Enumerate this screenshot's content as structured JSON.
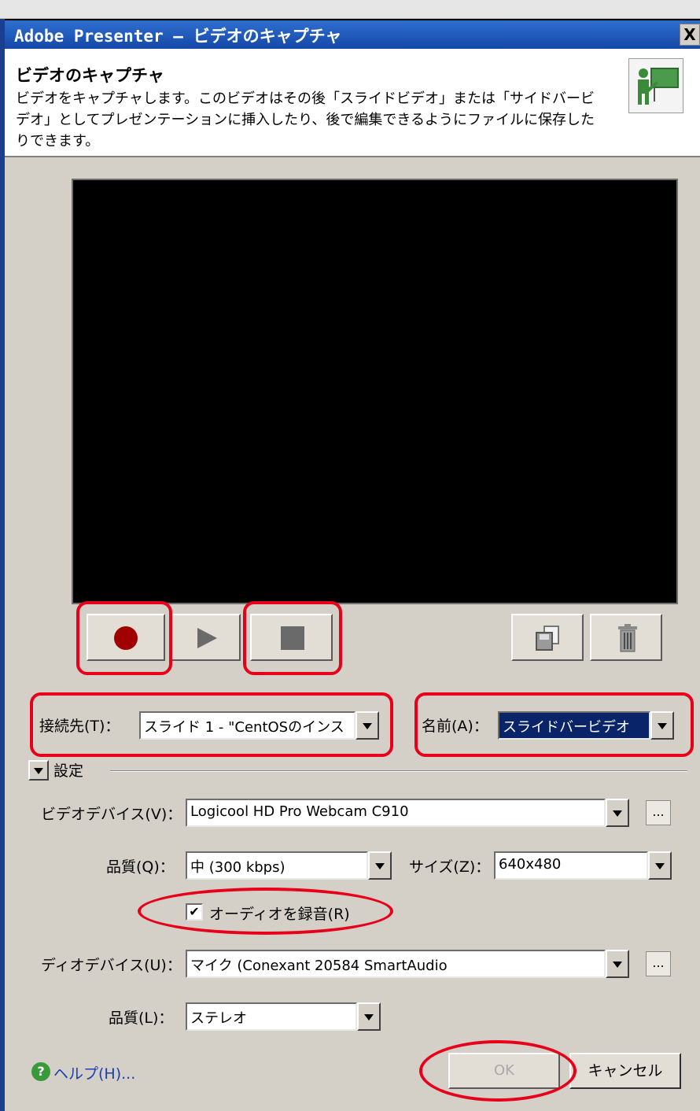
{
  "window": {
    "title": "Adobe Presenter – ビデオのキャプチャ",
    "close_glyph": "X"
  },
  "header": {
    "title": "ビデオのキャプチャ",
    "description": "ビデオをキャプチャします。このビデオはその後「スライドビデオ」または「サイドバービデオ」としてプレゼンテーションに挿入したり、後で編集できるようにファイルに保存したりできます。",
    "icon": "presenter-icon"
  },
  "controls": {
    "record": {
      "icon": "record-icon",
      "color": "#a00000"
    },
    "play": {
      "icon": "play-icon"
    },
    "stop": {
      "icon": "stop-icon"
    },
    "save": {
      "icon": "save-icon"
    },
    "delete": {
      "icon": "trash-icon"
    }
  },
  "target": {
    "label": "接続先(T)：",
    "value": "スライド 1 - \"CentOSのインス"
  },
  "name": {
    "label": "名前(A)：",
    "value": "スライドバービデオ"
  },
  "settings": {
    "label": "設定",
    "video_device": {
      "label": "ビデオデバイス(V)：",
      "value": "Logicool HD Pro Webcam C910",
      "more": "..."
    },
    "video_quality": {
      "label": "品質(Q)：",
      "value": "中 (300 kbps)"
    },
    "size": {
      "label": "サイズ(Z)：",
      "value": "640x480"
    },
    "record_audio": {
      "label": "オーディオを録音(R)",
      "checked": true,
      "check_glyph": "✔"
    },
    "audio_device": {
      "label": "ディオデバイス(U)：",
      "value": "マイク (Conexant 20584 SmartAudio",
      "more": "..."
    },
    "audio_quality": {
      "label": "品質(L)：",
      "value": "ステレオ"
    }
  },
  "footer": {
    "help": "ヘルプ(H)...",
    "help_glyph": "?",
    "ok": "OK",
    "cancel": "キャンセル"
  },
  "colors": {
    "annotation": "#e8001a",
    "titlebar": "#1448a8",
    "selection": "#0a246a"
  }
}
